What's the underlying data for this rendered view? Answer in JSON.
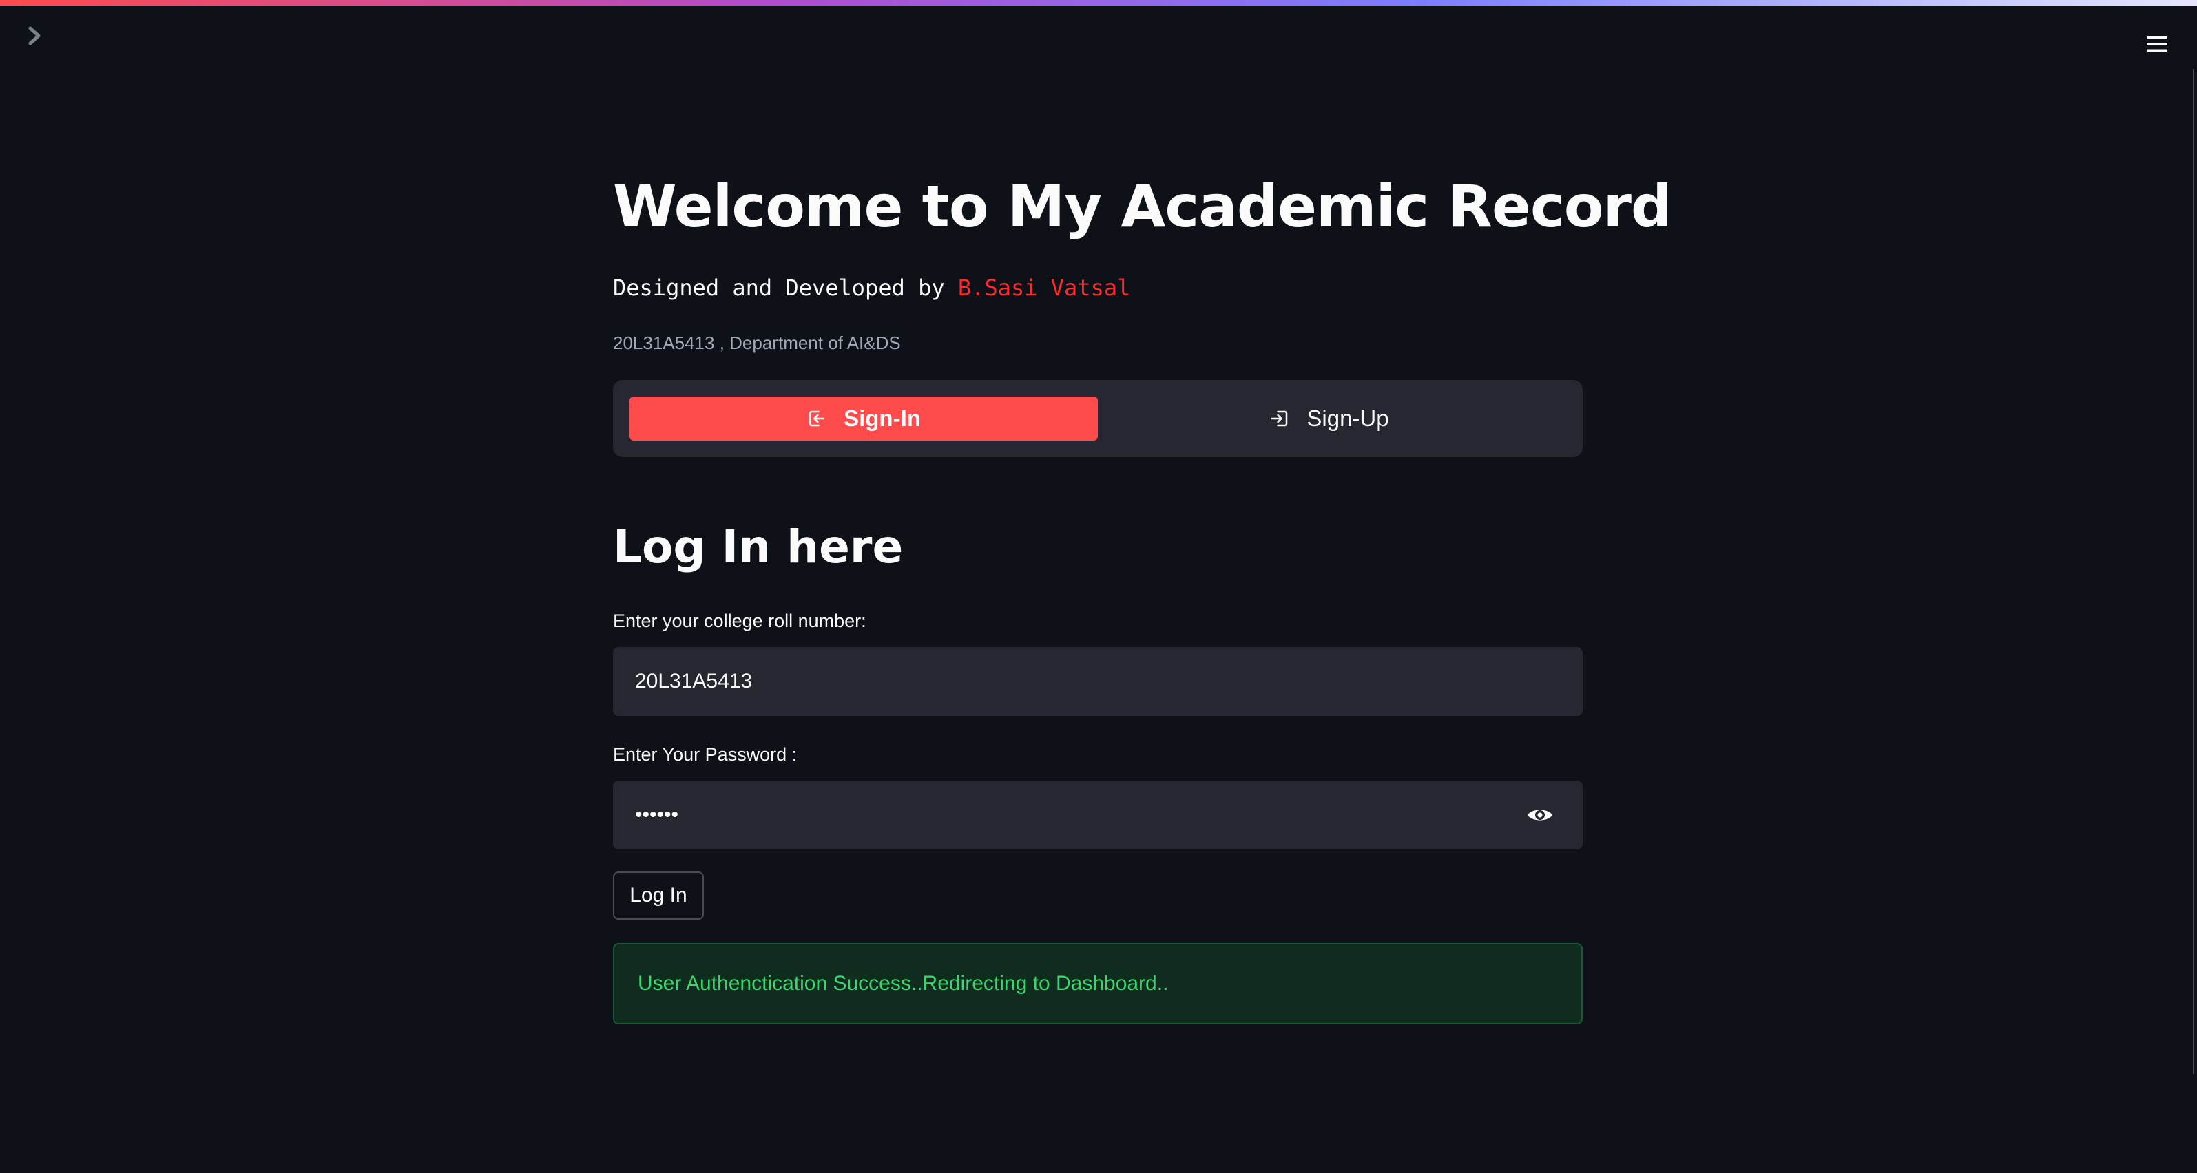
{
  "header": {
    "sidebar_toggle_icon": "chevron-right-icon",
    "menu_icon": "hamburger-menu-icon"
  },
  "main": {
    "title": "Welcome to My Academic Record",
    "designed_prefix": "Designed and Developed by ",
    "designed_author": "B.Sasi Vatsal",
    "department": "20L31A5413 , Department of AI&DS",
    "tabs": [
      {
        "label": "Sign-In",
        "icon": "sign-in-icon",
        "selected": true
      },
      {
        "label": "Sign-Up",
        "icon": "sign-up-icon",
        "selected": false
      }
    ],
    "heading": "Log In here",
    "roll_label": "Enter your college roll number:",
    "roll_value": "20L31A5413",
    "password_label": "Enter Your Password :",
    "password_value": "••••••",
    "login_button": "Log In",
    "success_message": "User Authenctication Success..Redirecting to Dashboard.."
  },
  "colors": {
    "background": "#0e1117",
    "accent": "#ff4b4b",
    "author": "#ff2b2b",
    "surface": "#262730",
    "success_text": "#3dd56d",
    "success_bg": "#0f2c1f"
  }
}
